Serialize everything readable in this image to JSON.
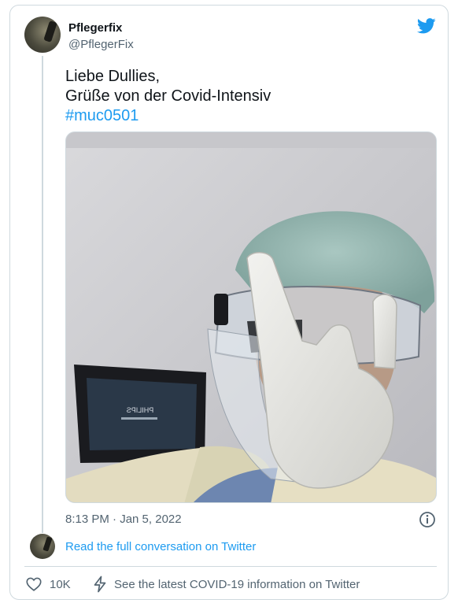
{
  "author": {
    "name": "Pflegerfix",
    "handle": "@PflegerFix"
  },
  "tweet": {
    "line1": "Liebe Dullies,",
    "line2": "Grüße von der Covid-Intensiv",
    "hashtag": "#muc0501"
  },
  "media": {
    "monitor_brand": "PHILIPS"
  },
  "timestamp": "8:13 PM · Jan 5, 2022",
  "read_conversation": "Read the full conversation on Twitter",
  "actions": {
    "likes": "10K",
    "covid_info": "See the latest COVID-19 information on Twitter"
  },
  "icons": {
    "brand": "twitter-bird-icon",
    "info": "info-icon",
    "like": "heart-icon",
    "covid": "lightning-bolt-icon"
  },
  "colors": {
    "accent": "#1d9bf0",
    "secondary_text": "#536471",
    "border": "#cfd9de"
  }
}
